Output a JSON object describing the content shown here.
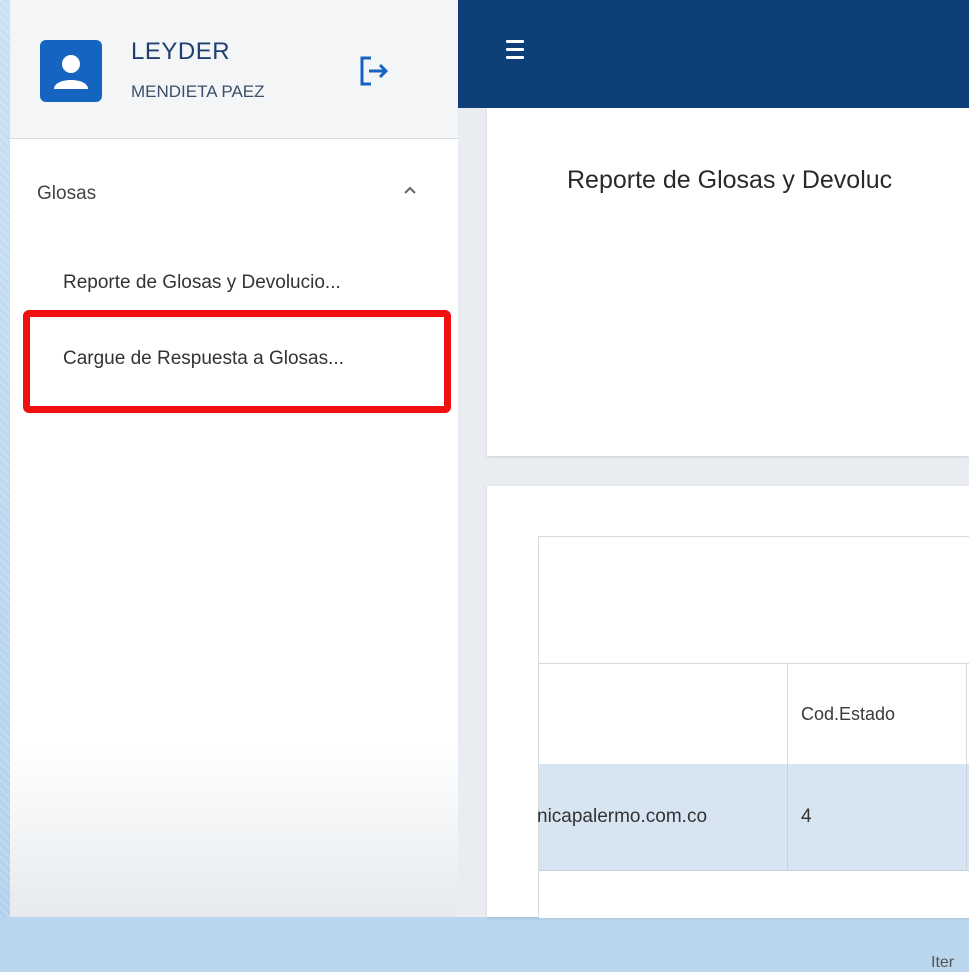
{
  "user": {
    "first_name": "LEYDER",
    "last_name": "MENDIETA PAEZ",
    "avatar_icon": "user-icon",
    "logout_icon": "logout-icon"
  },
  "sidebar": {
    "group_label": "Glosas",
    "group_icon": "chevron-up-icon",
    "items": [
      {
        "label": "Reporte de Glosas y Devolucio..."
      },
      {
        "label": "Cargue de Respuesta a Glosas..."
      }
    ],
    "highlight_color": "#ef1010"
  },
  "topbar": {
    "menu_icon": "menu-icon",
    "color": "#0f3f79"
  },
  "main": {
    "page_title": "Reporte de Glosas y Devoluc",
    "table": {
      "column_header": "Cod.Estado",
      "row_email": "nicapalermo.com.co",
      "row_status": "4",
      "footer_partial": "Iter"
    }
  }
}
